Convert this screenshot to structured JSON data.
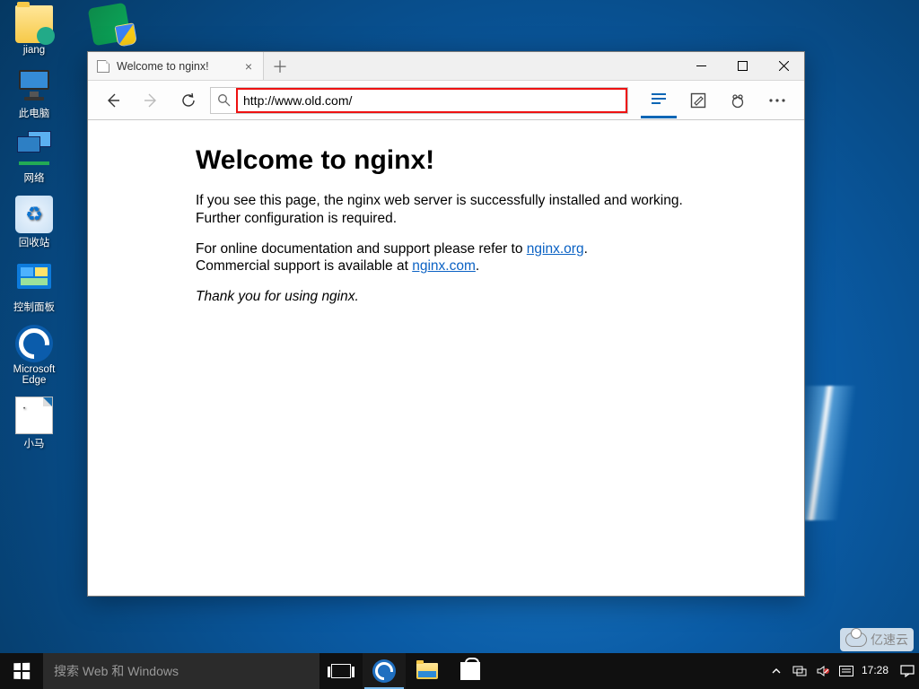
{
  "desktop": {
    "icons": [
      {
        "label": "jiang",
        "kind": "folder-user"
      },
      {
        "label": "",
        "kind": "forms-shield"
      },
      {
        "label": "此电脑",
        "kind": "pc"
      },
      {
        "label": "网络",
        "kind": "network"
      },
      {
        "label": "回收站",
        "kind": "recycle"
      },
      {
        "label": "控制面板",
        "kind": "control-panel"
      },
      {
        "label": "Microsoft Edge",
        "kind": "edge"
      },
      {
        "label": "小马",
        "kind": "textfile"
      }
    ]
  },
  "browser": {
    "tab_title": "Welcome to nginx!",
    "address": "http://www.old.com/",
    "page": {
      "heading": "Welcome to nginx!",
      "p1": "If you see this page, the nginx web server is successfully installed and working. Further configuration is required.",
      "p2_a": "For online documentation and support please refer to ",
      "link1": "nginx.org",
      "p2_b": ".",
      "p3_a": "Commercial support is available at ",
      "link2": "nginx.com",
      "p3_b": ".",
      "thanks": "Thank you for using nginx."
    }
  },
  "taskbar": {
    "search_placeholder": "搜索 Web 和 Windows",
    "time": "17:28"
  },
  "watermark": "亿速云"
}
